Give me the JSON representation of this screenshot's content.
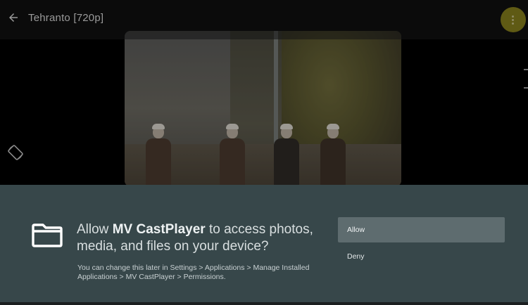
{
  "top_bar": {
    "title": "Tehranto [720p]",
    "back_icon": "arrow-back-icon",
    "menu_icon": "more-vert-icon",
    "menu_color": "#5f5a14"
  },
  "player": {
    "rotate_icon": "screen-rotation-icon"
  },
  "dialog": {
    "background": "#37474a",
    "icon": "folder-icon",
    "prompt_prefix": "Allow ",
    "app_name": "MV CastPlayer",
    "prompt_suffix": " to access photos, media, and files on your device?",
    "note": "You can change this later in Settings > Applications > Manage Installed Applications > MV CastPlayer > Permissions.",
    "allow_label": "Allow",
    "deny_label": "Deny"
  }
}
